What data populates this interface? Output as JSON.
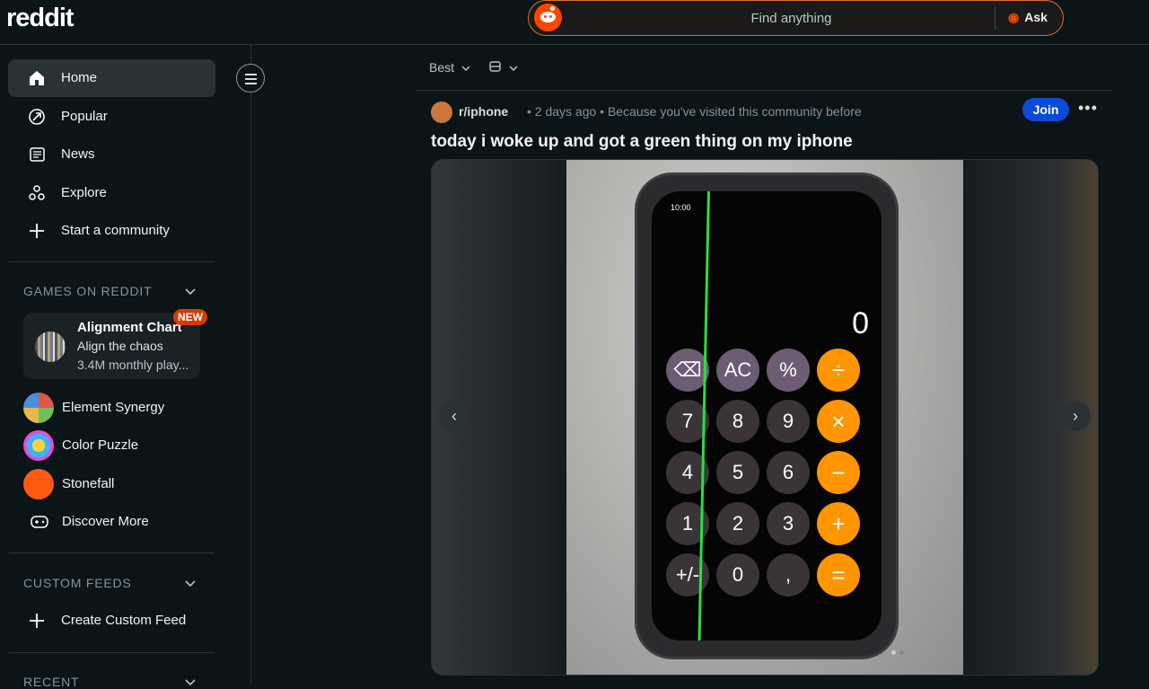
{
  "header": {
    "logo": "reddit",
    "search_placeholder": "Find anything",
    "ask_label": "Ask"
  },
  "sidebar": {
    "nav": [
      {
        "label": "Home",
        "icon": "home-icon",
        "active": true
      },
      {
        "label": "Popular",
        "icon": "popular-icon"
      },
      {
        "label": "News",
        "icon": "news-icon"
      },
      {
        "label": "Explore",
        "icon": "explore-icon"
      },
      {
        "label": "Start a community",
        "icon": "plus-icon"
      }
    ],
    "games_heading": "GAMES ON REDDIT",
    "featured_game": {
      "title": "Alignment Chart",
      "subtitle": "Align the chaos",
      "stats": "3.4M monthly play...",
      "badge": "NEW"
    },
    "games": [
      {
        "label": "Element Synergy"
      },
      {
        "label": "Color Puzzle"
      },
      {
        "label": "Stonefall"
      },
      {
        "label": "Discover More"
      }
    ],
    "custom_feeds_heading": "CUSTOM FEEDS",
    "create_custom_feed": "Create Custom Feed",
    "recent_heading": "RECENT"
  },
  "feed": {
    "sort_label": "Best",
    "post": {
      "subreddit": "r/iphone",
      "meta": "• 2 days ago • Because you've visited this community before",
      "join_label": "Join",
      "more_label": "•••",
      "title": "today i woke up and got a green thing on my iphone",
      "phone_time": "10:00",
      "calc_display": "0",
      "keys": [
        [
          "⌫",
          "AC",
          "%",
          "÷"
        ],
        [
          "7",
          "8",
          "9",
          "×"
        ],
        [
          "4",
          "5",
          "6",
          "−"
        ],
        [
          "1",
          "2",
          "3",
          "+"
        ],
        [
          "+/-",
          "0",
          ",",
          "="
        ]
      ]
    }
  }
}
